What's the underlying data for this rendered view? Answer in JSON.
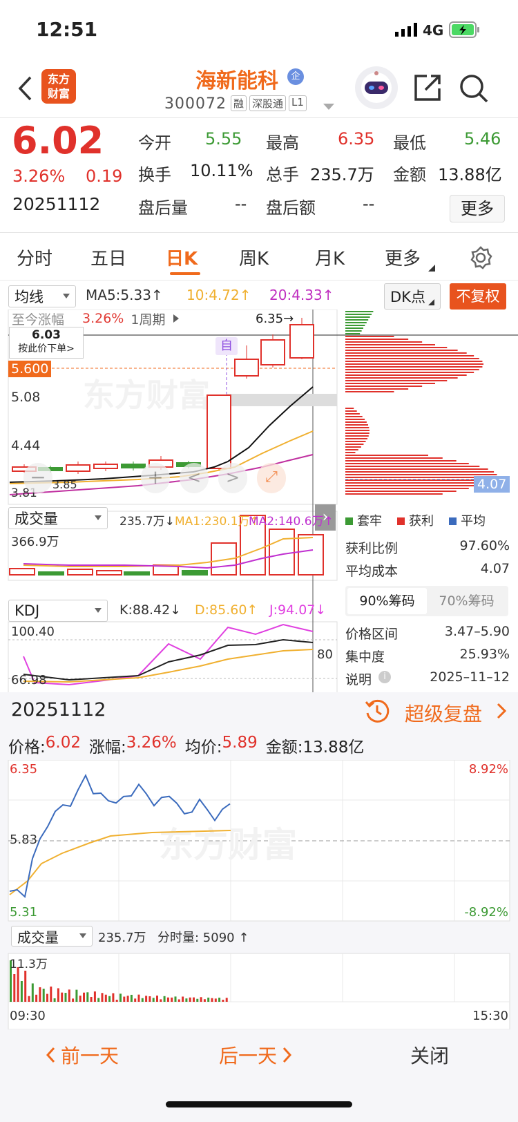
{
  "status": {
    "time": "12:51",
    "network": "4G"
  },
  "header": {
    "stock_name": "海新能科",
    "badge": "企",
    "code": "300072",
    "tags": [
      "融",
      "深股通",
      "L1"
    ],
    "logo_line1": "东方",
    "logo_line2": "财富"
  },
  "quote": {
    "price": "6.02",
    "change_pct": "3.26%",
    "change": "0.19",
    "date": "20251112",
    "fields": [
      {
        "label": "今开",
        "value": "5.55",
        "color": "green"
      },
      {
        "label": "最高",
        "value": "6.35",
        "color": "red"
      },
      {
        "label": "最低",
        "value": "5.46",
        "color": "green"
      },
      {
        "label": "换手",
        "value": "10.11%",
        "color": "black"
      },
      {
        "label": "总手",
        "value": "235.7万",
        "color": "black"
      },
      {
        "label": "金额",
        "value": "13.88亿",
        "color": "black"
      },
      {
        "label": "盘后量",
        "value": "--",
        "color": "black"
      },
      {
        "label": "盘后额",
        "value": "--",
        "color": "black"
      }
    ],
    "more_button": "更多"
  },
  "tabs": [
    "分时",
    "五日",
    "日K",
    "周K",
    "月K",
    "更多"
  ],
  "kline": {
    "ma_select": "均线",
    "ma5": "MA5:5.33↑",
    "ma10": "10:4.72↑",
    "ma20": "20:4.33↑",
    "dk_button": "DK点",
    "fq_button": "不复权",
    "tooltip_label": "至今涨幅",
    "tooltip_pct": "3.26%",
    "tooltip_period": "1周期",
    "order_price": "6.03",
    "order_hint": "按此价下单>",
    "price_tag": "5.600",
    "high_tag": "6.35→",
    "self_tag": "自",
    "cost_tag": "4.07",
    "y_labels": [
      "5.08",
      "4.44",
      "3.81"
    ],
    "low_mark": "3.85"
  },
  "volume": {
    "select": "成交量",
    "vol": "235.7万↓",
    "ma1": "MA1:230.1万↑",
    "ma2": "MA2:140.6万↑",
    "max": "366.9万"
  },
  "kdj": {
    "select": "KDJ",
    "k": "K:88.42↓",
    "d": "D:85.60↑",
    "j": "J:94.07↓",
    "top": "100.40",
    "bottom": "66.98",
    "right": "80"
  },
  "chips": {
    "legend": [
      "套牢",
      "获利",
      "平均"
    ],
    "rows": [
      {
        "label": "获利比例",
        "value": "97.60%"
      },
      {
        "label": "平均成本",
        "value": "4.07"
      }
    ],
    "tab1": "90%筹码",
    "tab2": "70%筹码",
    "rows2": [
      {
        "label": "价格区间",
        "value": "3.47–5.90"
      },
      {
        "label": "集中度",
        "value": "25.93%"
      },
      {
        "label": "说明",
        "value": "2025–11–12"
      }
    ]
  },
  "replay": {
    "date": "20251112",
    "link": "超级复盘",
    "info": [
      {
        "label": "价格:",
        "value": "6.02",
        "color": "red"
      },
      {
        "label": "涨幅:",
        "value": "3.26%",
        "color": "red"
      },
      {
        "label": "均价:",
        "value": "5.89",
        "color": "red"
      },
      {
        "label": "金额:",
        "value": "13.88亿",
        "color": "black"
      }
    ],
    "y_top": "6.35",
    "y_mid": "5.83",
    "y_bot": "5.31",
    "pct_top": "8.92%",
    "pct_bot": "-8.92%",
    "vol_select": "成交量",
    "vol_total": "235.7万",
    "vol_min": "分时量: 5090 ↑",
    "vol_max": "11.3万",
    "t_start": "09:30",
    "t_end": "15:30"
  },
  "footer": {
    "prev": "前一天",
    "next": "后一天",
    "close": "关闭"
  },
  "watermark": "东方财富",
  "colors": {
    "red": "#e0312b",
    "green": "#3c9a34",
    "orange": "#f06a1c",
    "blue": "#3b6bbd"
  }
}
